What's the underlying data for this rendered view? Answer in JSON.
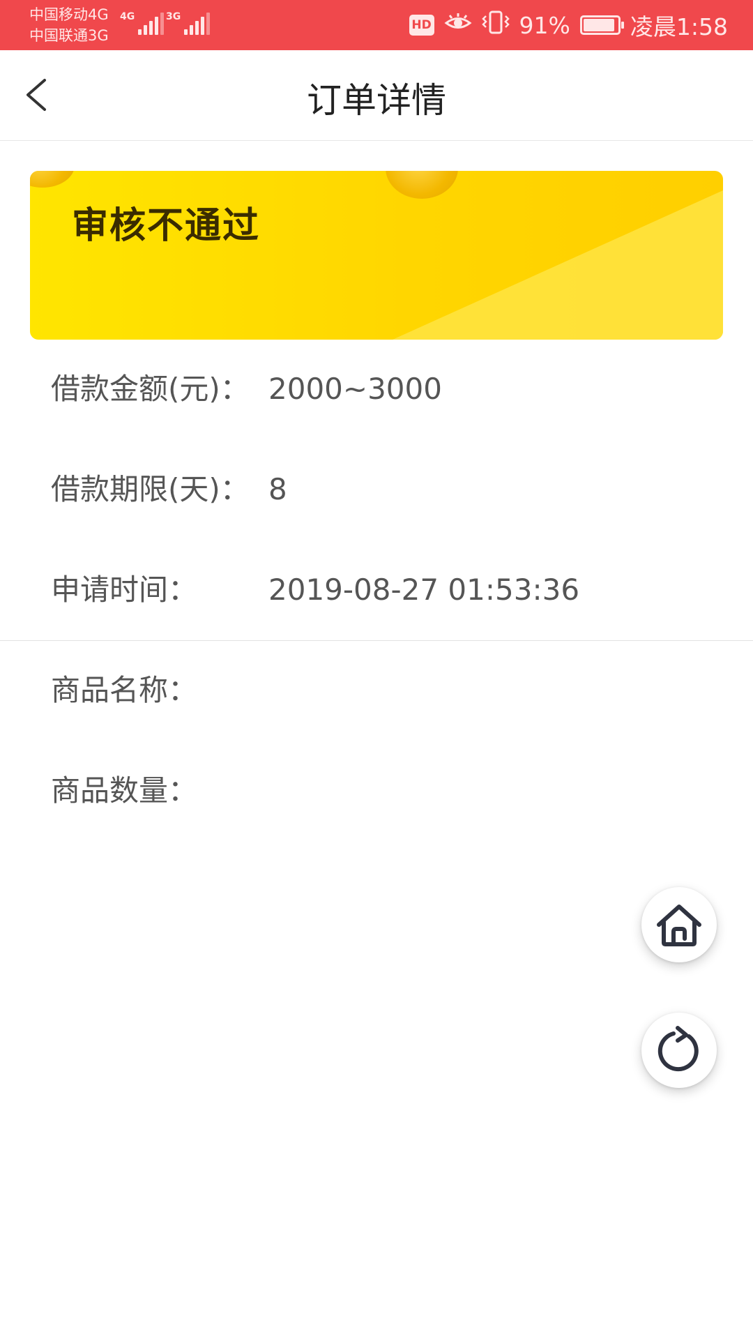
{
  "status_bar": {
    "carrier_1": "中国移动4G",
    "carrier_2": "中国联通3G",
    "signal_1_tag": "4G",
    "signal_2_tag": "3G",
    "hd_badge": "HD",
    "battery_percent": "91%",
    "battery_level": 0.91,
    "time": "凌晨1:58"
  },
  "header": {
    "title": "订单详情",
    "back_icon": "chevron-left-icon"
  },
  "status_card": {
    "title": "审核不通过",
    "colors": {
      "primary": "#ffdf00",
      "accent": "#f3b800"
    }
  },
  "order_info": {
    "amount_label": "借款金额(元)：",
    "amount_value": "2000~3000",
    "term_label": "借款期限(天)：",
    "term_value": "8",
    "apply_time_label": "申请时间：",
    "apply_time_value": "2019-08-27 01:53:36"
  },
  "product_info": {
    "name_label": "商品名称：",
    "name_value": "",
    "quantity_label": "商品数量：",
    "quantity_value": ""
  },
  "floating_buttons": {
    "home_icon": "home-icon",
    "refresh_icon": "refresh-icon"
  },
  "theme": {
    "status_bar_color": "#f0484c",
    "text_primary": "#222222",
    "text_secondary": "#555555"
  }
}
